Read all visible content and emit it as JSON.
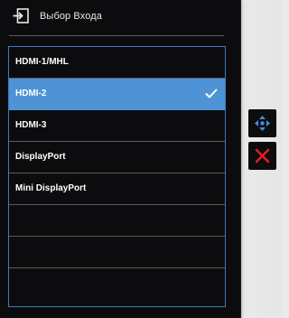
{
  "osd": {
    "title": "Выбор Входа",
    "header_icon": "input-source-icon",
    "inputs": [
      {
        "label": "HDMI-1/MHL",
        "selected": false
      },
      {
        "label": "HDMI-2",
        "selected": true
      },
      {
        "label": "HDMI-3",
        "selected": false
      },
      {
        "label": "DisplayPort",
        "selected": false
      },
      {
        "label": "Mini DisplayPort",
        "selected": false
      },
      {
        "label": "",
        "selected": false
      },
      {
        "label": "",
        "selected": false
      },
      {
        "label": "",
        "selected": false
      }
    ]
  },
  "side_controls": {
    "navigate_icon": "four-way-arrows-icon",
    "close_icon": "close-icon"
  },
  "colors": {
    "osd_background": "#0c0c0e",
    "selection": "#4e93d6",
    "list_border": "#3f7bbf",
    "navigate_icon": "#3f8fe6",
    "close_icon": "#e0201c",
    "background": "#e9e9e9"
  }
}
